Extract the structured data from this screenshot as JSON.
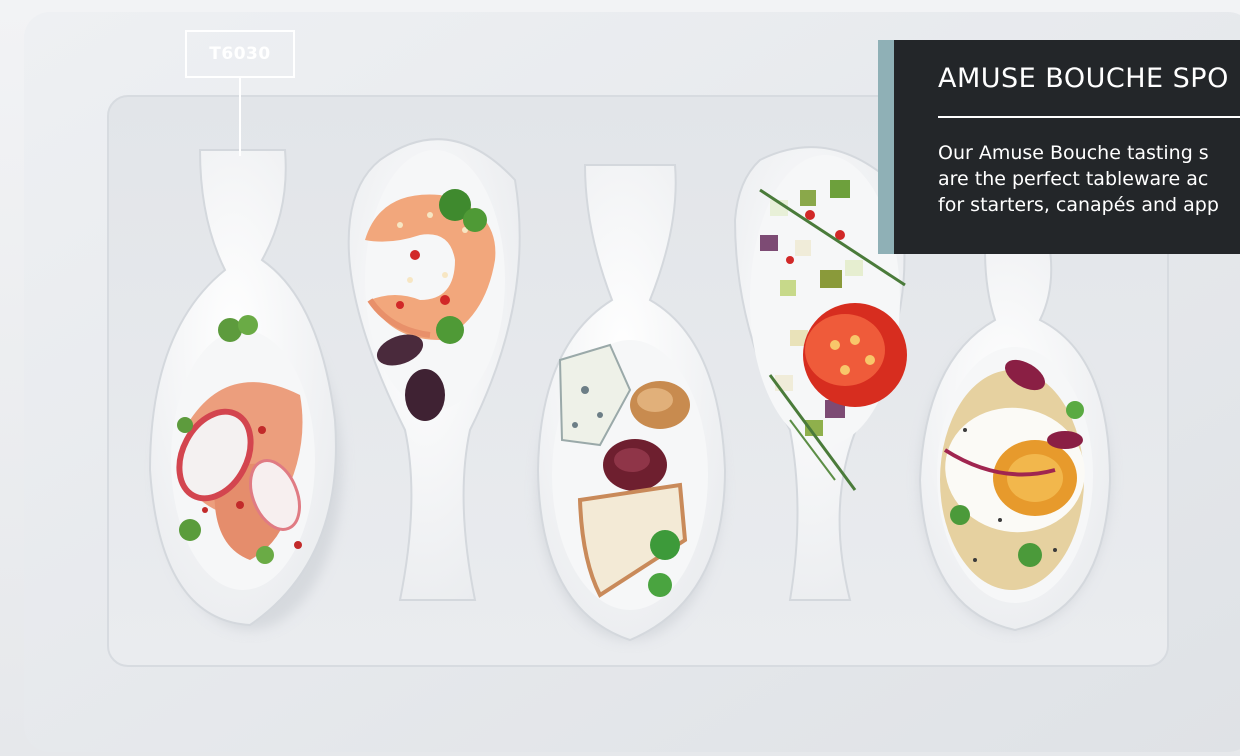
{
  "product_code": "T6030",
  "info_panel": {
    "title": "AMUSE BOUCHE SPO",
    "description_lines": [
      "Our Amuse Bouche tasting s",
      "are the perfect tableware ac",
      "for starters, canapés and app"
    ]
  },
  "colors": {
    "panel_background": "#232629",
    "panel_accent": "#8fb0b6",
    "tray": "#e4e7eb"
  },
  "photo": {
    "subject": "five-spoons-on-white-tray",
    "spoons": [
      "spoon-salmon",
      "spoon-prawn",
      "spoon-cheese",
      "spoon-salad",
      "spoon-egg"
    ]
  }
}
